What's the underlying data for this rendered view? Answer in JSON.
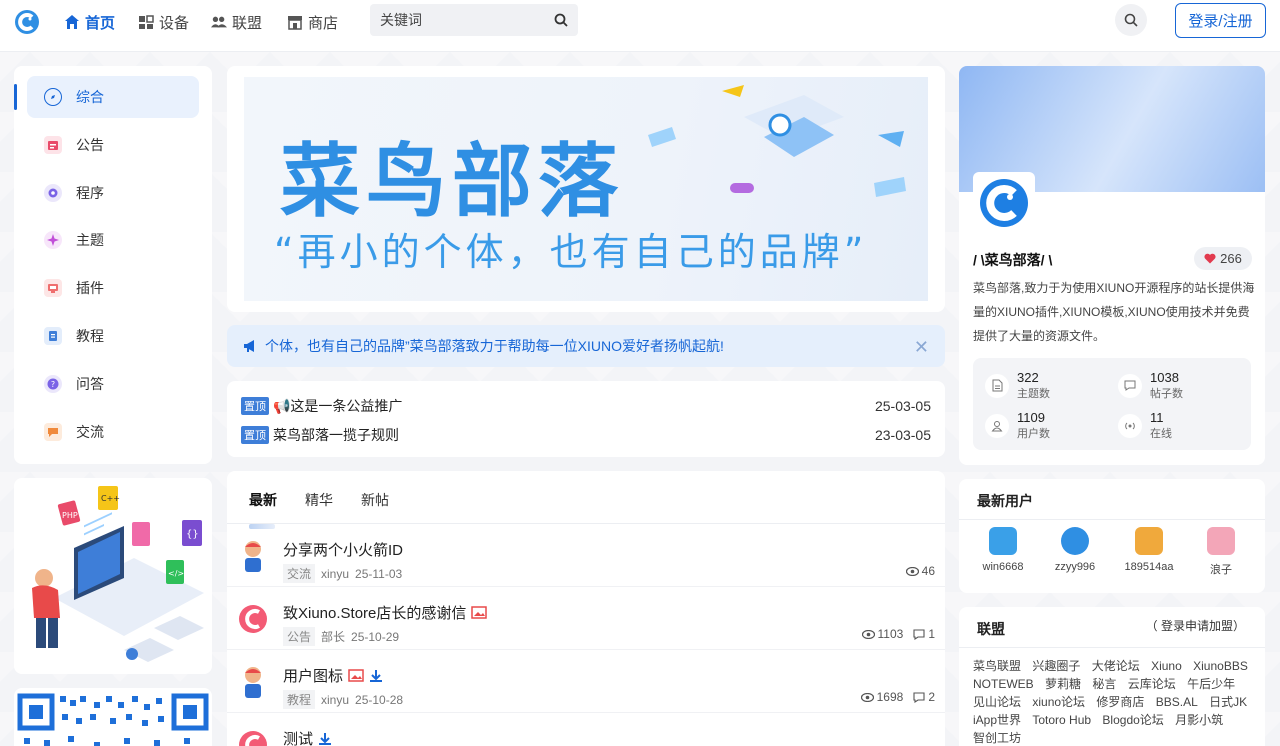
{
  "nav": {
    "items": [
      {
        "label": "首页",
        "icon": "home-icon"
      },
      {
        "label": "设备",
        "icon": "devices-icon"
      },
      {
        "label": "联盟",
        "icon": "users-icon"
      },
      {
        "label": "商店",
        "icon": "store-icon"
      }
    ],
    "search_placeholder": "关键词",
    "login_label": "登录/注册"
  },
  "sidebar": {
    "items": [
      {
        "label": "综合",
        "icon": "compass-icon",
        "color": "#1766d6"
      },
      {
        "label": "公告",
        "icon": "notice-icon",
        "color": "#e94b6a"
      },
      {
        "label": "程序",
        "icon": "gear-icon",
        "color": "#7a63e6"
      },
      {
        "label": "主题",
        "icon": "theme-icon",
        "color": "#c14fd8"
      },
      {
        "label": "插件",
        "icon": "plugin-icon",
        "color": "#ef6e6e"
      },
      {
        "label": "教程",
        "icon": "book-icon",
        "color": "#3e7ed8"
      },
      {
        "label": "问答",
        "icon": "question-icon",
        "color": "#7a63e6"
      },
      {
        "label": "交流",
        "icon": "chat-icon",
        "color": "#f08a3c"
      }
    ]
  },
  "banner": {
    "title": "菜鸟部落",
    "subtitle": "“再小的个体，也有自己的品牌”"
  },
  "notice": {
    "text": "个体，也有自己的品牌”菜鸟部落致力于帮助每一位XIUNO爱好者扬帆起航!"
  },
  "sticky": [
    {
      "tag": "置顶",
      "title": "📢这是一条公益推广",
      "date": "25-03-05"
    },
    {
      "tag": "置顶",
      "title": "菜鸟部落一揽子规则",
      "date": "23-03-05"
    }
  ],
  "tabs": [
    "最新",
    "精华",
    "新帖"
  ],
  "threads": [
    {
      "title": "分享两个小火箭ID",
      "category": "交流",
      "author": "xinyu",
      "date": "25-11-03",
      "views": "46",
      "comments": "",
      "avatar": "user",
      "img": false,
      "dl": false
    },
    {
      "title": "致Xiuno.Store店长的感谢信",
      "category": "公告",
      "author": "部长",
      "date": "25-10-29",
      "views": "1103",
      "comments": "1",
      "avatar": "logo",
      "img": true,
      "dl": false
    },
    {
      "title": "用户图标",
      "category": "教程",
      "author": "xinyu",
      "date": "25-10-28",
      "views": "1698",
      "comments": "2",
      "avatar": "user",
      "img": true,
      "dl": true
    },
    {
      "title": "测试",
      "category": "",
      "author": "",
      "date": "",
      "views": "",
      "comments": "",
      "avatar": "logo",
      "img": false,
      "dl": true
    }
  ],
  "profile": {
    "name": "/ \\菜鸟部落/ \\",
    "likes": "266",
    "description": "菜鸟部落,致力于为使用XIUNO开源程序的站长提供海量的XIUNO插件,XIUNO模板,XIUNO使用技术并免费提供了大量的资源文件。",
    "stats": [
      {
        "value": "322",
        "label": "主题数",
        "icon": "document-icon"
      },
      {
        "value": "1038",
        "label": "帖子数",
        "icon": "comment-icon"
      },
      {
        "value": "1109",
        "label": "用户数",
        "icon": "user-icon"
      },
      {
        "value": "11",
        "label": "在线",
        "icon": "online-icon"
      }
    ]
  },
  "new_users": {
    "title": "最新用户",
    "users": [
      {
        "name": "win6668",
        "color": "#3aa0e8"
      },
      {
        "name": "zzyy996",
        "color": "#2f8fe3"
      },
      {
        "name": "189514aa",
        "color": "#f0a93c"
      },
      {
        "name": "浪子",
        "color": "#f3a6b8"
      }
    ]
  },
  "alliance": {
    "title": "联盟",
    "apply": "（ 登录申请加盟）",
    "links": [
      "菜鸟联盟",
      "兴趣圈子",
      "大佬论坛",
      "Xiuno",
      "XiunoBBS",
      "NOTEWEB",
      "萝莉糖",
      "秘言",
      "云库论坛",
      "午后少年",
      "见山论坛",
      "xiuno论坛",
      "修罗商店",
      "BBS.AL",
      "日式JK",
      "iApp世界",
      "Totoro Hub",
      "Blogdo论坛",
      "月影小筑",
      "智创工坊"
    ]
  }
}
